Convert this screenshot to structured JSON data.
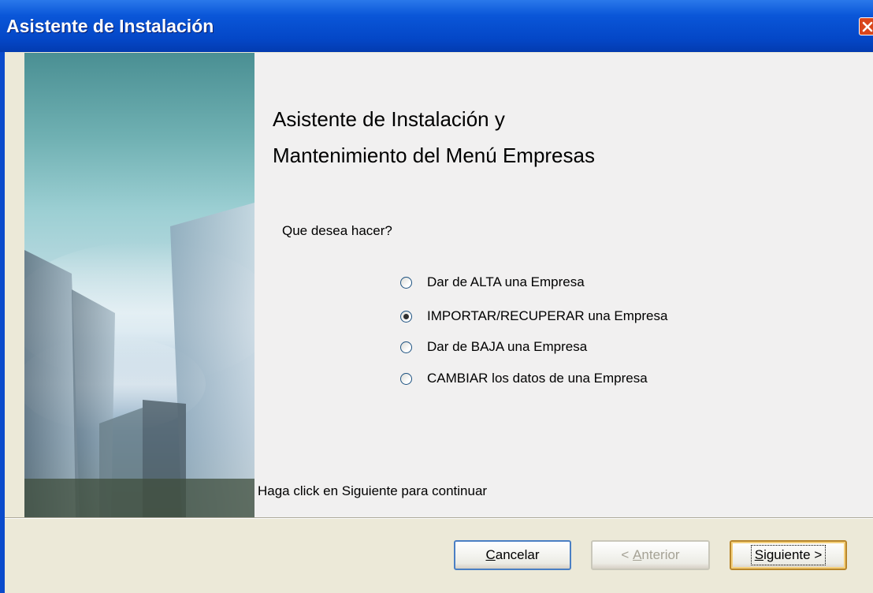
{
  "window": {
    "title": "Asistente de Instalación",
    "close_icon": "close-icon"
  },
  "content": {
    "heading_line1": "Asistente de Instalación y",
    "heading_line2": "Mantenimiento del Menú  Empresas",
    "question": "Que desea hacer?",
    "options": [
      {
        "label": "Dar de ALTA una Empresa",
        "selected": false
      },
      {
        "label": "IMPORTAR/RECUPERAR una  Empresa",
        "selected": true
      },
      {
        "label": "Dar de BAJA una Empresa",
        "selected": false
      },
      {
        "label": "CAMBIAR los datos de una Empresa",
        "selected": false
      }
    ],
    "hint": "Haga click en Siguiente para continuar"
  },
  "buttons": {
    "cancel_mnemonic": "C",
    "cancel_rest": "ancelar",
    "prev_prefix": "< ",
    "prev_mnemonic": "A",
    "prev_rest": "nterior",
    "next_mnemonic": "S",
    "next_rest": "iguiente >"
  }
}
